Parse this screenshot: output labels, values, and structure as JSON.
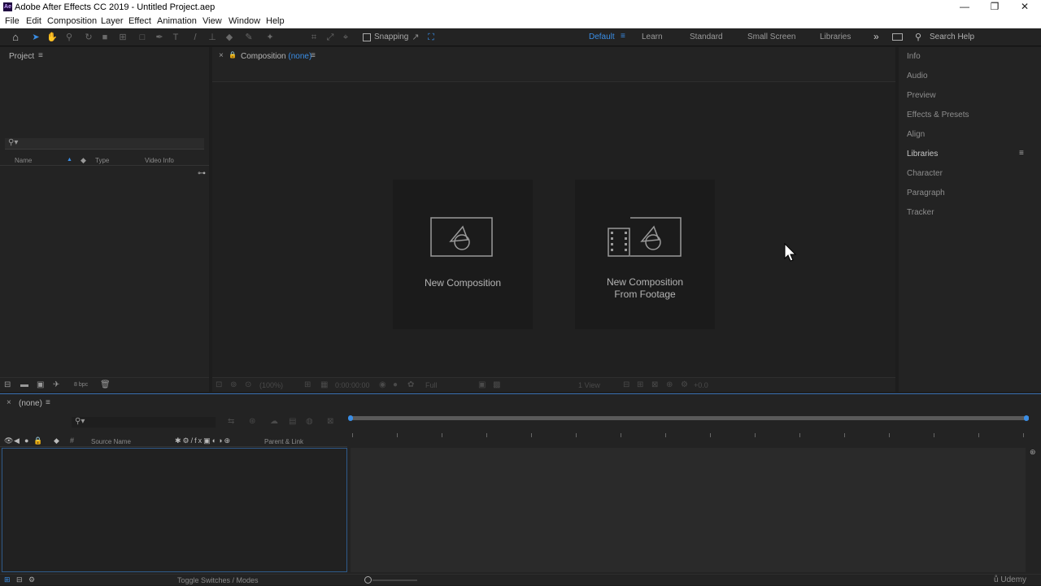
{
  "app": {
    "title": "Adobe After Effects CC 2019 - Untitled Project.aep",
    "logo_text": "Ae"
  },
  "window_controls": {
    "minimize": "—",
    "maximize": "❐",
    "close": "✕"
  },
  "menu": [
    "File",
    "Edit",
    "Composition",
    "Layer",
    "Effect",
    "Animation",
    "View",
    "Window",
    "Help"
  ],
  "toolbar": {
    "snapping_label": "Snapping",
    "workspaces": [
      "Default",
      "Learn",
      "Standard",
      "Small Screen",
      "Libraries"
    ],
    "active_workspace": "Default",
    "more": "»",
    "search_placeholder": "Search Help"
  },
  "project_panel": {
    "title": "Project",
    "columns": [
      "Name",
      "Type",
      "Video Info"
    ],
    "bpc": "8 bpc"
  },
  "composition_panel": {
    "title_prefix": "Composition",
    "title_value": "(none)",
    "new_comp_label": "New Composition",
    "new_comp_footage_line1": "New Composition",
    "new_comp_footage_line2": "From Footage",
    "footer_zoom": "(100%)",
    "footer_time": "0:00:00:00",
    "footer_res": "Full",
    "footer_view": "1 View"
  },
  "right_panel": {
    "items": [
      "Info",
      "Audio",
      "Preview",
      "Effects & Presets",
      "Align",
      "Libraries",
      "Character",
      "Paragraph",
      "Tracker"
    ],
    "active": "Libraries"
  },
  "timeline": {
    "tab_label": "(none)",
    "col_source": "Source Name",
    "col_parent": "Parent & Link",
    "toggle_label": "Toggle Switches / Modes"
  },
  "watermark": "Udemy",
  "accent_color": "#3a8ee6"
}
